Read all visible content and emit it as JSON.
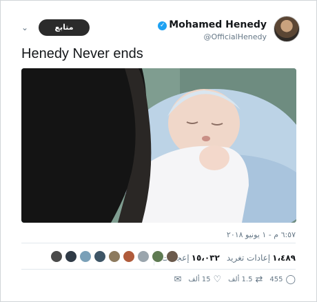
{
  "author": {
    "display_name": "Mohamed Henedy",
    "handle": "@OfficialHenedy",
    "verified_icon": "verified-badge-icon"
  },
  "header": {
    "follow_label": "متابع",
    "menu_icon": "chevron-down-icon"
  },
  "tweet": {
    "text": "Henedy Never ends",
    "timestamp": "٦:٥٧ م - ١ يونيو ٢٠١٨"
  },
  "stats": {
    "retweets_count": "١،٤٨٩",
    "retweets_label": "إعادات تغريد",
    "likes_count": "١٥،٠٣٢",
    "likes_label": "إعجابات"
  },
  "actions": {
    "reply_count": "455",
    "retweet_count": "1.5 ألف",
    "like_count": "15 ألف",
    "reply_icon": "reply-icon",
    "retweet_icon": "retweet-icon",
    "like_icon": "heart-icon",
    "message_icon": "direct-message-icon"
  },
  "colors": {
    "accent": "#1da1f2",
    "button": "#2b2b2b",
    "muted": "#657786"
  }
}
